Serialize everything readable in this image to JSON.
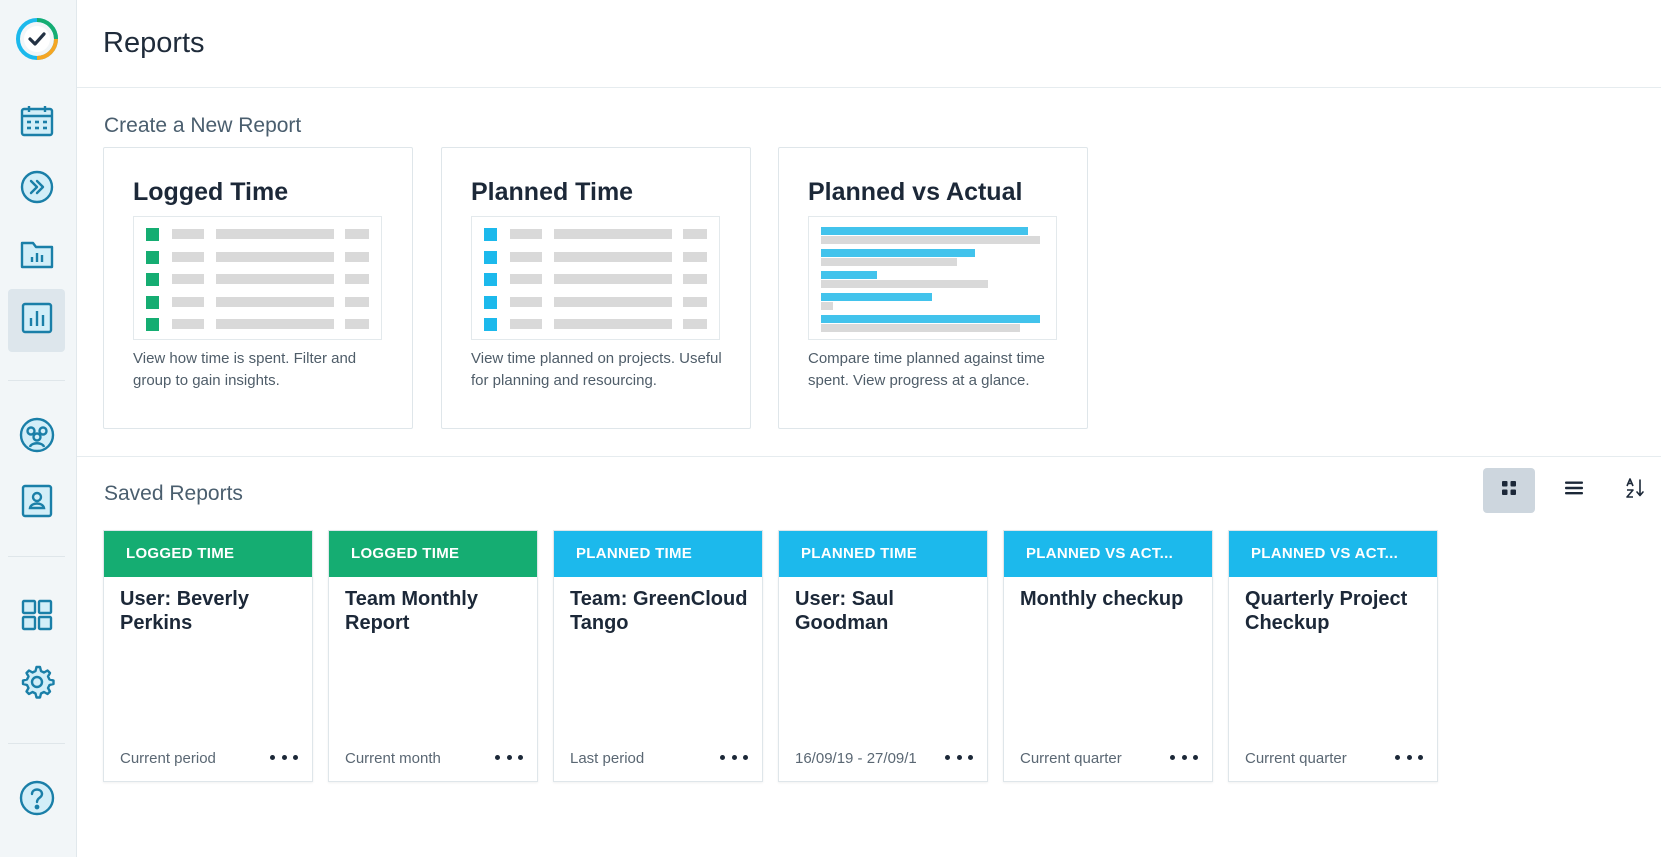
{
  "header": {
    "title": "Reports"
  },
  "sidebar": {
    "items": [
      {
        "name": "logo-icon"
      },
      {
        "name": "calendar-icon"
      },
      {
        "name": "fast-forward-icon"
      },
      {
        "name": "projects-folder-icon"
      },
      {
        "name": "reports-chart-icon",
        "active": true
      },
      {
        "name": "team-icon"
      },
      {
        "name": "person-card-icon"
      },
      {
        "name": "apps-grid-icon"
      },
      {
        "name": "settings-gear-icon"
      },
      {
        "name": "help-icon"
      }
    ]
  },
  "create": {
    "heading": "Create a New Report",
    "cards": [
      {
        "title": "Logged Time",
        "description": "View how time is spent. Filter and group to gain insights.",
        "accent": "#15ad72"
      },
      {
        "title": "Planned Time",
        "description": "View time planned on projects. Useful for planning and resourcing.",
        "accent": "#1cb9ec"
      },
      {
        "title": "Planned vs Actual",
        "description": "Compare time planned against time spent. View progress at a glance.",
        "accent": "#42c3ec"
      }
    ]
  },
  "saved": {
    "heading": "Saved Reports",
    "view_controls": [
      {
        "name": "grid-view-icon",
        "active": true
      },
      {
        "name": "list-view-icon",
        "active": false
      },
      {
        "name": "sort-az-icon",
        "active": false
      }
    ],
    "reports": [
      {
        "type": "LOGGED TIME",
        "color": "green",
        "title": "User: Beverly Perkins",
        "period": "Current period"
      },
      {
        "type": "LOGGED TIME",
        "color": "green",
        "title": "Team Monthly Report",
        "period": "Current month"
      },
      {
        "type": "PLANNED TIME",
        "color": "blue",
        "title": "Team: GreenCloud Tango",
        "period": "Last period"
      },
      {
        "type": "PLANNED TIME",
        "color": "blue",
        "title": "User: Saul Goodman",
        "period": "16/09/19 - 27/09/1"
      },
      {
        "type": "PLANNED VS ACT...",
        "color": "blue",
        "title": "Monthly checkup",
        "period": "Current quarter"
      },
      {
        "type": "PLANNED VS ACT...",
        "color": "blue",
        "title": "Quarterly Project Checkup",
        "period": "Current quarter"
      }
    ]
  },
  "colors": {
    "green": "#15ad72",
    "blue": "#1cb9ec",
    "icon": "#1a7fa8"
  }
}
